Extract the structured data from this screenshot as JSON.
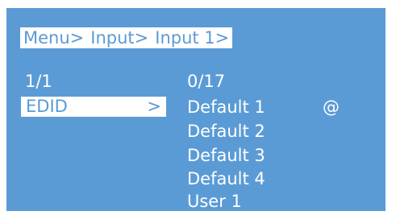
{
  "breadcrumb": [
    "Menu>",
    "Input>",
    "Input 1>"
  ],
  "menu": {
    "page": "1/1",
    "selected_item": "EDID",
    "selected_arrow": ">"
  },
  "submenu": {
    "count": "0/17",
    "options": [
      "Default 1",
      "Default 2",
      "Default 3",
      "Default 4",
      "User 1"
    ],
    "active_marker": "@"
  },
  "colors": {
    "screen_bg": "#5b9bd5",
    "highlight_bg": "#ffffff",
    "text": "#ffffff"
  }
}
